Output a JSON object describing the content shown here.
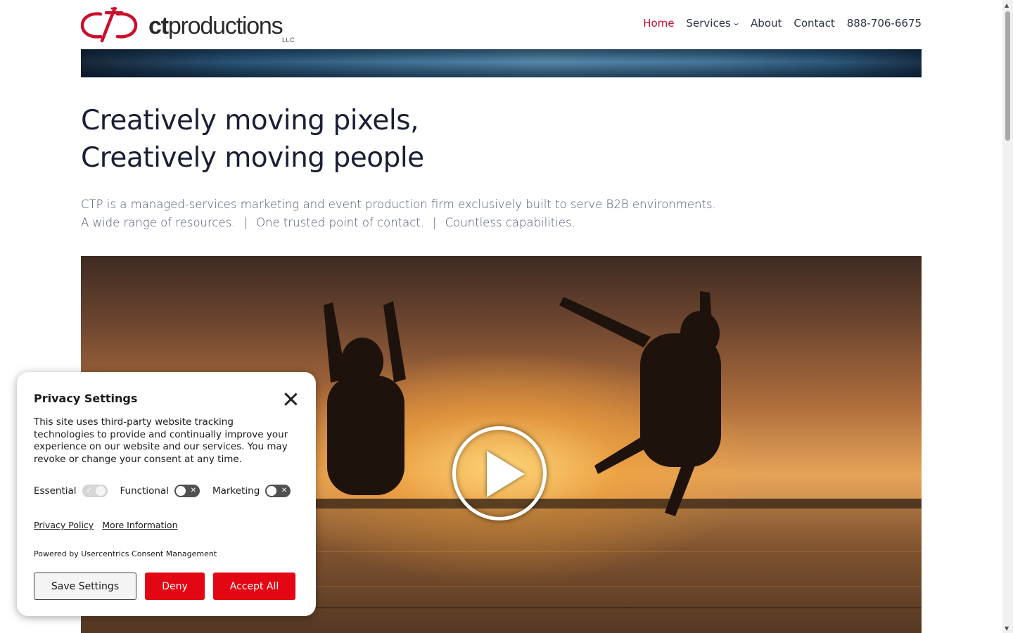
{
  "brand": {
    "logo_text_bold": "ct",
    "logo_text_rest": "productions",
    "logo_suffix": "LLC",
    "accent_color": "#c8102e"
  },
  "nav": {
    "items": [
      {
        "label": "Home",
        "active": true
      },
      {
        "label": "Services",
        "dropdown": true
      },
      {
        "label": "About"
      },
      {
        "label": "Contact"
      },
      {
        "label": "888-706-6675"
      }
    ]
  },
  "hero": {
    "headline_line1": "Creatively moving pixels,",
    "headline_line2": "Creatively moving people",
    "intro_line1": "CTP is a managed-services marketing and event production firm exclusively built to serve B2B environments.",
    "intro_part1": "A wide range of resources.",
    "intro_part2": "One trusted point of contact.",
    "intro_part3": "Countless capabilities.",
    "separator": "|"
  },
  "video": {
    "play_icon": "play-icon"
  },
  "privacy": {
    "title": "Privacy Settings",
    "body": "This site uses third-party website tracking technologies to provide and continually improve your experience on our website and our services. You may revoke or change your consent at any time.",
    "toggles": [
      {
        "label": "Essential",
        "state": "on-locked"
      },
      {
        "label": "Functional",
        "state": "off"
      },
      {
        "label": "Marketing",
        "state": "off"
      }
    ],
    "link_policy": "Privacy Policy",
    "link_more": "More Information",
    "powered_by": "Powered by Usercentrics Consent Management",
    "button_save": "Save Settings",
    "button_deny": "Deny",
    "button_accept": "Accept All",
    "button_color": "#e30613"
  }
}
